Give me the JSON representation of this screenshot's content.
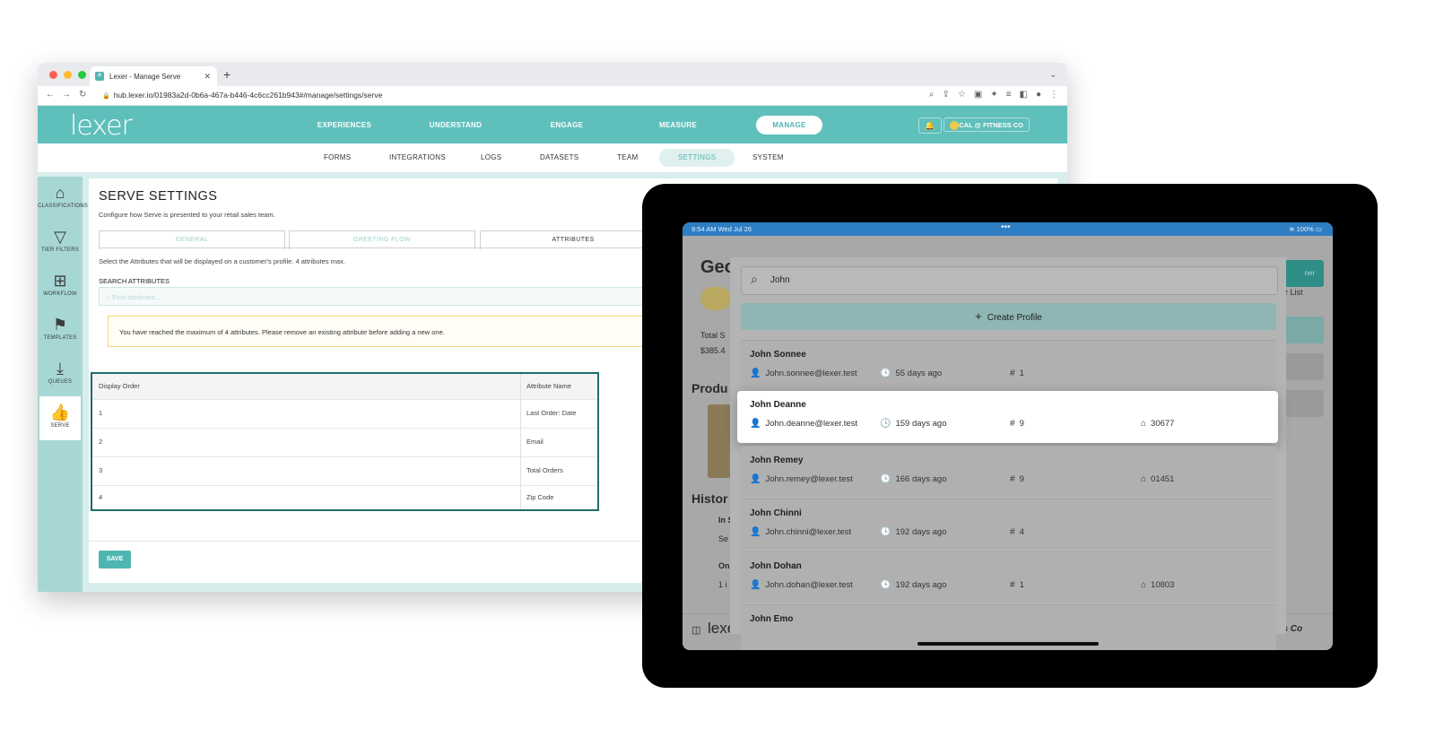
{
  "browser": {
    "tab_title": "Lexer - Manage Serve",
    "url": "hub.lexer.io/01983a2d-0b6a-467a-b446-4c6cc261b943#/manage/settings/serve"
  },
  "app": {
    "logo": "lexer",
    "main_nav": [
      "EXPERIENCES",
      "UNDERSTAND",
      "ENGAGE",
      "MEASURE",
      "MANAGE"
    ],
    "org_name": "CAL @ FITNESS CO",
    "sub_nav": [
      "FORMS",
      "INTEGRATIONS",
      "LOGS",
      "DATASETS",
      "TEAM",
      "SETTINGS",
      "SYSTEM"
    ],
    "sidebar": [
      "CLASSIFICATIONS",
      "TIER FILTERS",
      "WORKFLOW",
      "TEMPLATES",
      "QUEUES",
      "SERVE"
    ]
  },
  "serve": {
    "title": "SERVE SETTINGS",
    "subtitle": "Configure how Serve is presented to your retail sales team.",
    "tabs": [
      "GENERAL",
      "GREETING FLOW",
      "ATTRIBUTES"
    ],
    "select_text": "Select the Attributes that will be displayed on a customer's profile. 4 attributes max.",
    "search_label": "SEARCH ATTRIBUTES",
    "search_placeholder": "Find attributes...",
    "warning": "You have reached the maximum of 4 attributes. Please remove an existing attribute before adding a new one.",
    "table_headers": [
      "Display Order",
      "Attribute Name"
    ],
    "rows": [
      {
        "order": "1",
        "name": "Last Order: Date"
      },
      {
        "order": "2",
        "name": "Email"
      },
      {
        "order": "3",
        "name": "Total Orders"
      },
      {
        "order": "4",
        "name": "Zip Code"
      }
    ],
    "save_label": "SAVE"
  },
  "tablet": {
    "time": "9:54 AM  Wed Jul 26",
    "battery": "100%",
    "search_value": "John",
    "create_label": "Create Profile",
    "bg_texts": [
      "Geo",
      "Total S",
      "$385.4",
      "Produ",
      "Histor",
      "In S",
      "Se",
      "On",
      "1 i",
      "r List",
      "Fitness Co",
      "lexer",
      "ner"
    ],
    "profiles": [
      {
        "name": "John Sonnee",
        "email": "John.sonnee@lexer.test",
        "last": "55 days ago",
        "orders": "1",
        "zip": ""
      },
      {
        "name": "John Deanne",
        "email": "John.deanne@lexer.test",
        "last": "159 days ago",
        "orders": "9",
        "zip": "30677"
      },
      {
        "name": "John Remey",
        "email": "John.remey@lexer.test",
        "last": "166 days ago",
        "orders": "9",
        "zip": "01451"
      },
      {
        "name": "John Chinni",
        "email": "John.chinni@lexer.test",
        "last": "192 days ago",
        "orders": "4",
        "zip": ""
      },
      {
        "name": "John Dohan",
        "email": "John.dohan@lexer.test",
        "last": "192 days ago",
        "orders": "1",
        "zip": "10803"
      },
      {
        "name": "John Emo",
        "email": "",
        "last": "",
        "orders": "",
        "zip": ""
      }
    ]
  }
}
